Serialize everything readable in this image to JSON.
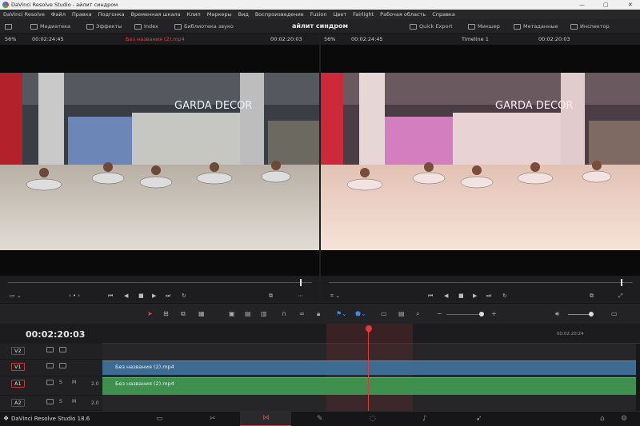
{
  "window": {
    "title": "DaVinci Resolve Studio - айлит синдром",
    "min": "—",
    "max": "▢",
    "close": "✕"
  },
  "menu": [
    "DaVinci Resolve",
    "Файл",
    "Правка",
    "Подгонка",
    "Временная шкала",
    "Клип",
    "Маркеры",
    "Вид",
    "Воспроизведение",
    "Fusion",
    "Цвет",
    "Fairlight",
    "Рабочая область",
    "Справка"
  ],
  "toolbar": {
    "media_pool": "Медиатека",
    "effects": "Эффекты",
    "index": "Index",
    "sound_library": "Библиотека звуко",
    "project_title": "айлит синдром",
    "quick_export": "Quick Export",
    "mixer": "Микшер",
    "metadata": "Метаданные",
    "inspector": "Инспектор"
  },
  "source_viewer": {
    "zoom": "56%",
    "duration": "00:02:24:45",
    "clip_name": "Без названия (2).mp4",
    "timecode": "00:02:20:03"
  },
  "timeline_viewer": {
    "zoom": "56%",
    "duration": "00:02:24:45",
    "timeline_name": "Timeline 1",
    "timecode": "00:02:20:03"
  },
  "timeline": {
    "timecode": "00:02:20:03",
    "ruler_label": "00:02:20:24",
    "tracks": [
      {
        "name": "V2"
      },
      {
        "name": "V1"
      },
      {
        "name": "A1",
        "level": "2.0"
      },
      {
        "name": "A2",
        "level": "2.0"
      }
    ],
    "video_clip": "Без названия (2).mp4",
    "audio_clip": "Без названия (2).mp4"
  },
  "footer": {
    "brand": "DaVinci Resolve Studio 18.6"
  },
  "colors": {
    "accent_red": "#e0453c",
    "video_clip": "#3d6b91",
    "audio_clip": "#3f8f4f",
    "playhead": "#e03a3a"
  }
}
